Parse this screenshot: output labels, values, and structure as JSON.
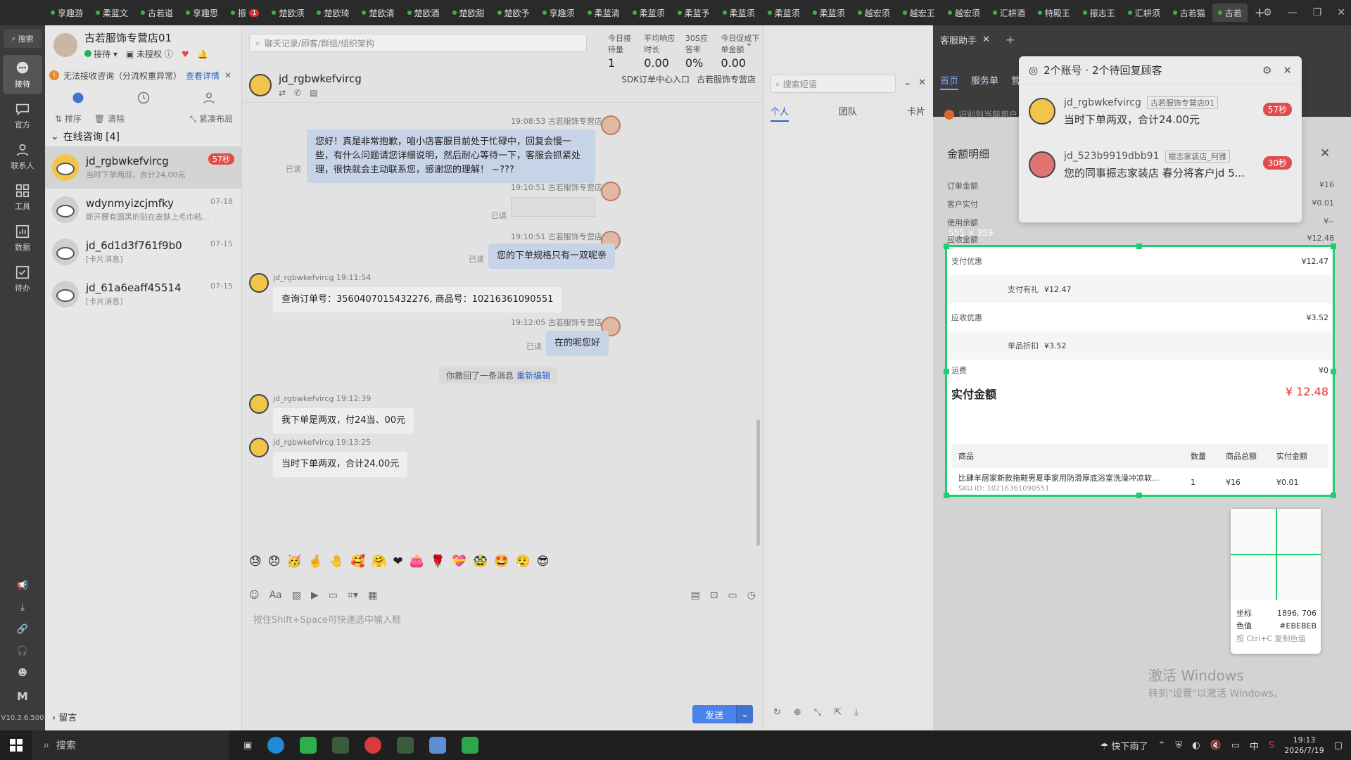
{
  "tabs": [
    {
      "label": "享趣游"
    },
    {
      "label": "柔蓝文"
    },
    {
      "label": "古若道"
    },
    {
      "label": "享趣思"
    },
    {
      "label": "振",
      "badge": "1"
    },
    {
      "label": "楚欧须"
    },
    {
      "label": "楚欧琦"
    },
    {
      "label": "楚欧清"
    },
    {
      "label": "楚欧酒"
    },
    {
      "label": "楚欧甜"
    },
    {
      "label": "楚欧予"
    },
    {
      "label": "享趣须"
    },
    {
      "label": "柔蓝清"
    },
    {
      "label": "柔蓝须"
    },
    {
      "label": "柔蓝予"
    },
    {
      "label": "柔蓝须"
    },
    {
      "label": "柔蓝须"
    },
    {
      "label": "柔蓝须"
    },
    {
      "label": "越宏须"
    },
    {
      "label": "越宏王"
    },
    {
      "label": "越宏须"
    },
    {
      "label": "汇耕酒"
    },
    {
      "label": "特殿王"
    },
    {
      "label": "振志王"
    },
    {
      "label": "汇耕须"
    },
    {
      "label": "古若猫"
    },
    {
      "label": "古若"
    }
  ],
  "rail": {
    "search": "搜索",
    "items": [
      {
        "label": "接待",
        "icon": "chat-icon"
      },
      {
        "label": "官方",
        "icon": "message-icon"
      },
      {
        "label": "联系人",
        "icon": "contact-icon"
      },
      {
        "label": "工具",
        "icon": "tools-icon"
      },
      {
        "label": "数据",
        "icon": "data-icon"
      },
      {
        "label": "待办",
        "icon": "todo-icon"
      }
    ],
    "version": "V10.3.6.500"
  },
  "shop": {
    "name": "古若服饰专营店01",
    "status": "接待",
    "auth": "未授权"
  },
  "warning": {
    "text": "无法接收咨询（分流权重异常）",
    "link": "查看详情"
  },
  "sort": {
    "sort": "排序",
    "clear": "清除",
    "layout": "紧凑布局"
  },
  "group": {
    "title": "在线咨询 [4]"
  },
  "sessions": [
    {
      "name": "jd_rgbwkefvircg",
      "preview": "当时下单两双，合计24.00元",
      "badge": "57秒",
      "time": ""
    },
    {
      "name": "wdynmyizcjmfky",
      "preview": "斯开腰有圆黑的贴在皮肤上毛巾粘...",
      "badge": "",
      "time": "07-18"
    },
    {
      "name": "jd_6d1d3f761f9b0",
      "preview": "[卡片消息]",
      "badge": "",
      "time": "07-15"
    },
    {
      "name": "jd_61a6eaff45514",
      "preview": "[卡片消息]",
      "badge": "",
      "time": "07-15"
    }
  ],
  "leave": "留言",
  "chat": {
    "search_placeholder": "聊天记录/顾客/群组/组织架构",
    "stats": [
      {
        "label": "今日接待量",
        "value": "1"
      },
      {
        "label": "平均响应时长",
        "value": "0.00"
      },
      {
        "label": "30S应答率",
        "value": "0%"
      },
      {
        "label": "今日促成下单金额",
        "value": "0.00"
      }
    ],
    "customer": "jd_rgbwkefvircg",
    "head_right": "SDK订单中心入口",
    "head_shop": "古若服饰专营店",
    "messages": {
      "m1_meta": "19:08:53  古若服饰专营店01",
      "m1_text": "您好！真是非常抱歉，咱小店客服目前处于忙碌中，回复会慢一些，有什么问题请您详细说明，然后耐心等待一下，客服会抓紧处理，很快就会主动联系您，感谢您的理解！ ~???",
      "read1": "已读",
      "m2_meta": "19:10:51  古若服饰专营店01",
      "read2": "已读",
      "m3_meta": "19:10:51  古若服饰专营店01",
      "m3_text": "您的下单规格只有一双呢亲",
      "read3": "已读",
      "m4_meta": "jd_rgbwkefvircg  19:11:54",
      "m4_text": "查询订单号：3560407015432276, 商品号：10216361090551",
      "m5_meta": "19:12:05  古若服饰专营店01",
      "m5_text": "在的呢您好",
      "read5": "已读",
      "recall": "你撤回了一条消息",
      "recall_link": "重新编辑",
      "m6_meta": "jd_rgbwkefvircg  19:12:39",
      "m6_text": "我下单是两双，付24当、00元",
      "m7_meta": "jd_rgbwkefvircg  19:13:25",
      "m7_text": "当时下单两双，合计24.00元"
    },
    "emojis": [
      "😓",
      "😞",
      "🥳",
      "🤞",
      "🤚",
      "🥰",
      "🤗",
      "❤",
      "👛",
      "🌹",
      "💝",
      "🥸",
      "🤩",
      "😮‍💨",
      "😎"
    ],
    "input_hint": "按住Shift+Space可快速选中输入框",
    "send": "发送"
  },
  "quick": {
    "search_placeholder": "搜索短语",
    "tabs": [
      "个人",
      "团队",
      "卡片"
    ]
  },
  "right": {
    "top_tab": "客服助手",
    "nav": [
      "首页",
      "服务单",
      "营"
    ],
    "warn": "识别到当前用户",
    "amount_title": "金额明细",
    "rows": [
      {
        "label": "订单金额",
        "value": "¥16"
      },
      {
        "label": "客户实付",
        "value": "¥0.01"
      },
      {
        "label": "使用余额",
        "value": "¥--"
      },
      {
        "label": "应收金额",
        "value": "¥12.48"
      }
    ],
    "dimension": "555 × 359"
  },
  "popup": {
    "title": "2个账号 · 2个待回复顾客",
    "items": [
      {
        "name": "jd_rgbwkefvircg",
        "tag": "古若服饰专营店01",
        "msg": "当时下单两双，合计24.00元",
        "time": "57秒"
      },
      {
        "name": "jd_523b9919dbb91",
        "tag": "振志家装店_阿雅",
        "msg": "您的同事振志家装店 春分将客户jd 5...",
        "time": "30秒"
      }
    ]
  },
  "capture": {
    "pay_discount": {
      "label": "支付优惠",
      "value": "¥12.47"
    },
    "pay_gift": {
      "label": "支付有礼",
      "value": "¥12.47"
    },
    "recv_discount": {
      "label": "应收优惠",
      "value": "¥3.52"
    },
    "single_discount": {
      "label": "单品折扣",
      "value": "¥3.52"
    },
    "shipping": {
      "label": "运费",
      "value": "¥0"
    },
    "total": {
      "label": "实付金额",
      "value": "¥ 12.48"
    },
    "table_head": [
      "商品",
      "数量",
      "商品总额",
      "实付金额"
    ],
    "row": {
      "name": "比肆羊居家新款拖鞋男夏季家用防滑厚底浴室洗澡冲凉软...",
      "sku": "SKU ID: 10216361090551",
      "qty": "1",
      "total": "¥16",
      "paid": "¥0.01"
    }
  },
  "magnifier": {
    "coord_label": "坐标",
    "coord": "1896, 706",
    "color_label": "色值",
    "color": "#EBEBEB",
    "hint": "按 Ctrl+C 复制色值"
  },
  "activate": {
    "line1": "激活 Windows",
    "line2": "转到\"设置\"以激活 Windows。"
  },
  "taskbar": {
    "search": "搜索",
    "weather": "快下雨了",
    "ime": "中",
    "time": "19:13",
    "date": "2026/7/19"
  },
  "colors": {
    "accent": "#4a84e8",
    "capture": "#1fcf6f",
    "badge": "#e04b4b"
  }
}
